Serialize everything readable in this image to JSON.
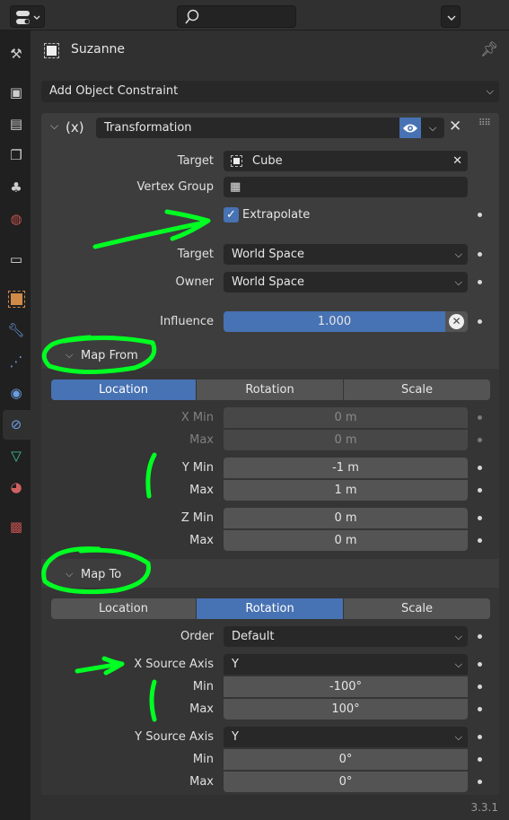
{
  "header": {
    "editor_type_icon": "properties-editor-icon",
    "search_placeholder": "",
    "search_icon": "search-icon"
  },
  "sidebar": {
    "tabs": [
      {
        "name": "tool",
        "icon": "tool-icon"
      },
      {
        "name": "render",
        "icon": "render-icon"
      },
      {
        "name": "output",
        "icon": "output-icon"
      },
      {
        "name": "view-layer",
        "icon": "view-layer-icon"
      },
      {
        "name": "scene",
        "icon": "scene-icon"
      },
      {
        "name": "world",
        "icon": "world-icon"
      },
      {
        "name": "collection",
        "icon": "collection-icon"
      },
      {
        "name": "object",
        "icon": "object-icon"
      },
      {
        "name": "modifiers",
        "icon": "wrench-icon"
      },
      {
        "name": "particles",
        "icon": "particles-icon"
      },
      {
        "name": "physics",
        "icon": "physics-icon"
      },
      {
        "name": "object-constraints",
        "icon": "constraint-icon",
        "active": true
      },
      {
        "name": "object-data",
        "icon": "mesh-data-icon"
      },
      {
        "name": "material",
        "icon": "material-icon"
      },
      {
        "name": "texture",
        "icon": "texture-icon"
      }
    ]
  },
  "object_name": "Suzanne",
  "add_constraint": "Add Object Constraint",
  "constraint": {
    "type_label": "(x)",
    "name": "Transformation",
    "target_label": "Target",
    "target_value": "Cube",
    "vertex_group_label": "Vertex Group",
    "vertex_group_value": "",
    "extrapolate_label": "Extrapolate",
    "extrapolate_checked": true,
    "target_space_label": "Target",
    "target_space_value": "World Space",
    "owner_space_label": "Owner",
    "owner_space_value": "World Space",
    "influence_label": "Influence",
    "influence_value": "1.000"
  },
  "map_from": {
    "title": "Map From",
    "tabs": [
      "Location",
      "Rotation",
      "Scale"
    ],
    "active_tab": "Location",
    "rows": [
      {
        "label": "X Min",
        "value": "0 m",
        "disabled": true
      },
      {
        "label": "Max",
        "value": "0 m",
        "disabled": true
      },
      {
        "label": "Y Min",
        "value": "-1 m"
      },
      {
        "label": "Max",
        "value": "1 m"
      },
      {
        "label": "Z Min",
        "value": "0 m"
      },
      {
        "label": "Max",
        "value": "0 m"
      }
    ]
  },
  "map_to": {
    "title": "Map To",
    "tabs": [
      "Location",
      "Rotation",
      "Scale"
    ],
    "active_tab": "Rotation",
    "order_label": "Order",
    "order_value": "Default",
    "x_source_label": "X Source Axis",
    "x_source_value": "Y",
    "x_min_label": "Min",
    "x_min_value": "-100°",
    "x_max_label": "Max",
    "x_max_value": "100°",
    "y_source_label": "Y Source Axis",
    "y_source_value": "Y",
    "y_min_label": "Min",
    "y_min_value": "0°",
    "y_max_label": "Max",
    "y_max_value": "0°"
  },
  "version": "3.3.1",
  "colors": {
    "accent": "#4772b3",
    "annotation": "#00ff22"
  }
}
